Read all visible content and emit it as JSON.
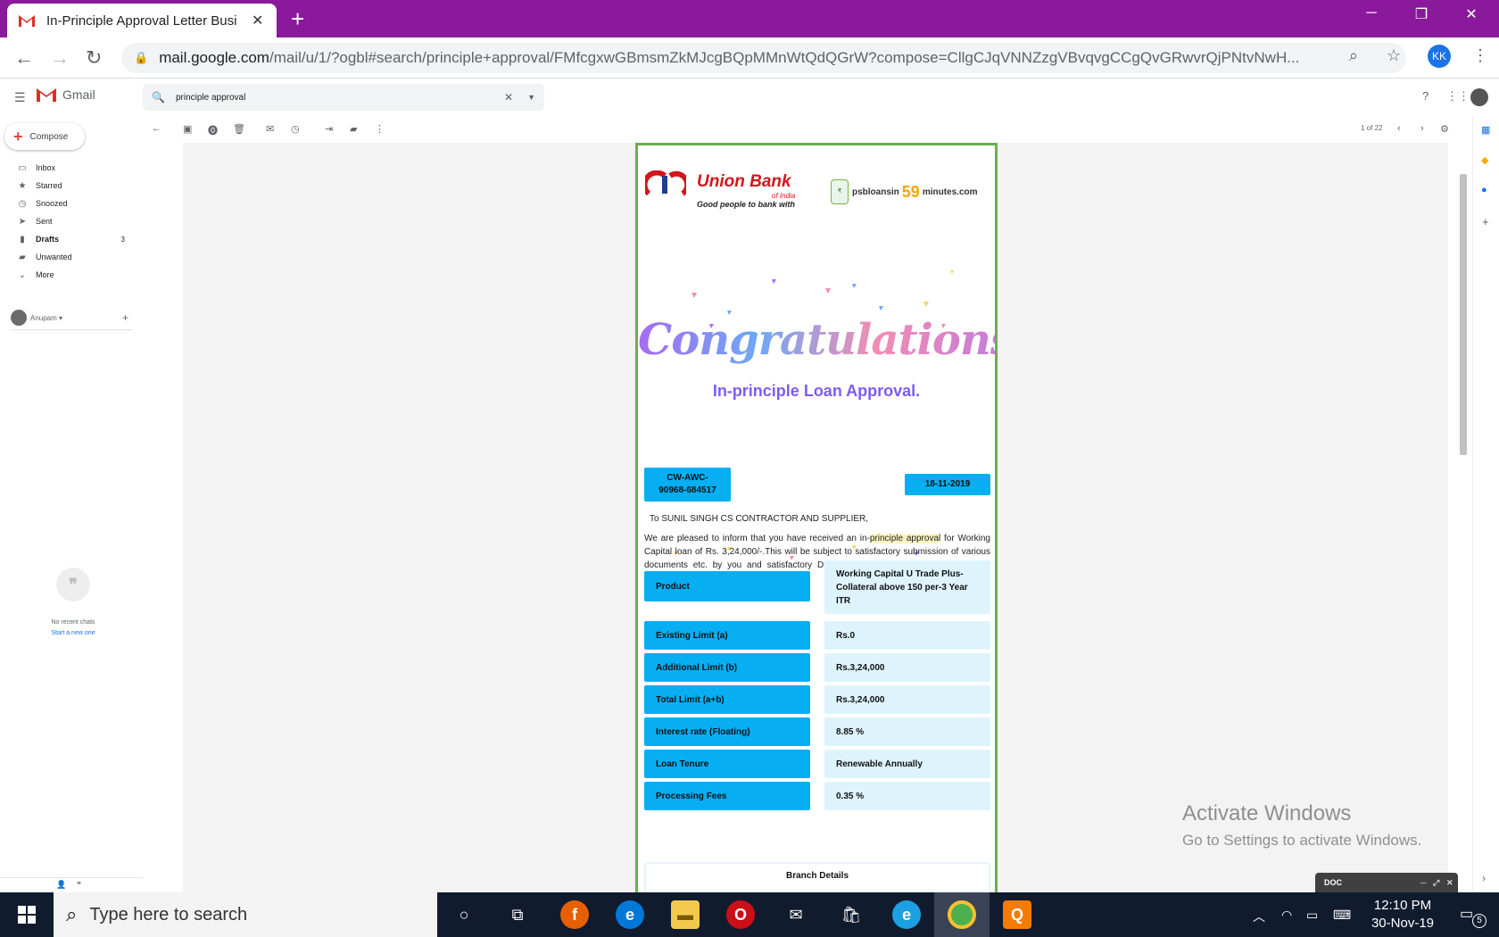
{
  "browser": {
    "tab_title": "In-Principle Approval Letter Busi",
    "url_domain": "mail.google.com",
    "url_path": "/mail/u/1/?ogbl#search/principle+approval/FMfcgxwGBmsmZkMJcgBQpMMnWtQdQGrW?compose=CllgCJqVNNZzgVBvqvgCCgQvGRwvrQjPNtvNwH...",
    "profile_initials": "KK"
  },
  "gmail": {
    "logo_text": "Gmail",
    "search_value": "principle approval",
    "compose_label": "Compose",
    "nav": [
      {
        "label": "Inbox",
        "icon": "inbox-icon",
        "count": ""
      },
      {
        "label": "Starred",
        "icon": "star-icon",
        "count": ""
      },
      {
        "label": "Snoozed",
        "icon": "clock-icon",
        "count": ""
      },
      {
        "label": "Sent",
        "icon": "send-icon",
        "count": ""
      },
      {
        "label": "Drafts",
        "icon": "draft-icon",
        "count": "3"
      },
      {
        "label": "Unwanted",
        "icon": "label-icon",
        "count": ""
      },
      {
        "label": "More",
        "icon": "chevron-down-icon",
        "count": ""
      }
    ],
    "hangouts_user": "Anupam",
    "no_chats": "No recent chats",
    "start_new": "Start a new one",
    "pager": "1 of 22"
  },
  "letter": {
    "bank_name": "Union Bank",
    "bank_sub": "of India",
    "bank_tagline": "Good people to bank with",
    "psb_a": "psbloansin",
    "psb_59": "59",
    "psb_b": "minutes.com",
    "congrats": "Congratulations",
    "approval_title": "In-principle Loan Approval.",
    "ref_number": "CW-AWC-90968-684517",
    "ref_line1": "CW-AWC-",
    "ref_line2": "90968-684517",
    "date": "18-11-2019",
    "addressee": "To SUNIL SINGH CS CONTRACTOR AND SUPPLIER,",
    "para_a": "We are pleased to inform that you have received an in-",
    "para_hl": "principle approval",
    "para_b": " for Working Capital loan of Rs. 3,24,000/-.This will be subject to satisfactory submission of various documents etc. by you and satisfactory Due Diligence and other Reports as per requirements of the Bank .",
    "rows": [
      {
        "label": "Product",
        "value": "Working Capital U Trade Plus-Collateral above 150 per-3 Year ITR"
      },
      {
        "label": "Existing Limit (a)",
        "value": "Rs.0"
      },
      {
        "label": "Additional Limit (b)",
        "value": "Rs.3,24,000"
      },
      {
        "label": "Total Limit (a+b)",
        "value": "Rs.3,24,000"
      },
      {
        "label": "Interest rate (Floating)",
        "value": "8.85 %"
      },
      {
        "label": "Loan Tenure",
        "value": "Renewable Annually"
      },
      {
        "label": "Processing Fees",
        "value": "0.35 %"
      }
    ],
    "branch_details": "Branch Details"
  },
  "overlay": {
    "activate_title": "Activate Windows",
    "activate_sub": "Go to Settings to activate Windows.",
    "doc_label": "DOC"
  },
  "taskbar": {
    "search_placeholder": "Type here to search",
    "time": "12:10 PM",
    "date": "30-Nov-19",
    "notif_count": "5"
  },
  "colors": {
    "chrome_frame": "#8a1a9b",
    "letter_border": "#6ab04c",
    "label_bg": "#07aef2",
    "value_bg": "#def4fd",
    "bank_red": "#d4141c"
  }
}
